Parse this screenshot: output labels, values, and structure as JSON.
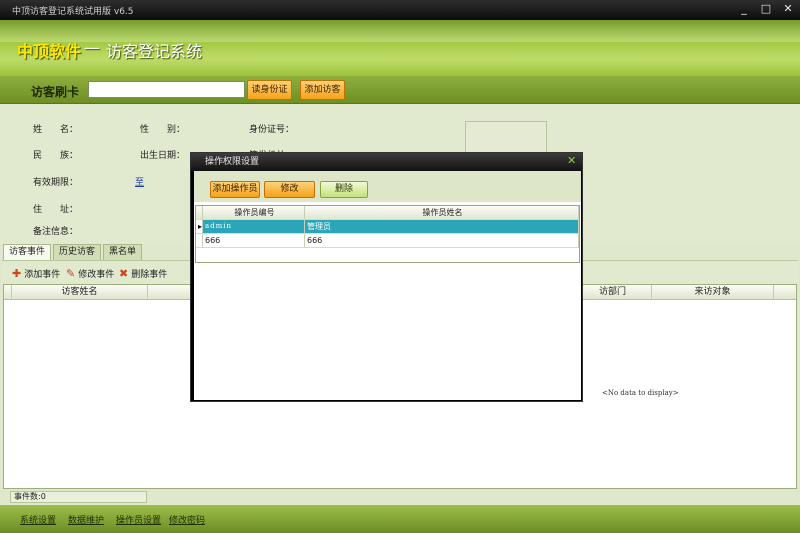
{
  "window": {
    "title": "中顶访客登记系统试用版 v6.5",
    "min": "_",
    "max": "□",
    "close": "✕"
  },
  "banner": {
    "brand": "中顶软件",
    "sep": "—",
    "subtitle": "访客登记系统"
  },
  "card": {
    "label": "访客刷卡",
    "input_value": "",
    "read_id_button": "读身份证",
    "add_visitor_button": "添加访客"
  },
  "info": {
    "name_label": "姓　　名：",
    "gender_label": "性　　别：",
    "id_label": "身份证号：",
    "ethnic_label": "民　　族：",
    "birth_label": "出生日期：",
    "issuer_label": "签发机关：",
    "valid_label": "有效期限：",
    "valid_to": "至",
    "address_label": "住　　址：",
    "remark_label": "备注信息："
  },
  "tabs": [
    "访客事件",
    "历史访客",
    "黑名单"
  ],
  "toolbar": {
    "add": "添加事件",
    "edit": "修改事件",
    "delete": "删除事件"
  },
  "grid": {
    "columns": [
      "访客姓名",
      "访部门",
      "来访对象"
    ],
    "empty": "<No data to display>"
  },
  "status": {
    "count": "事件数:0"
  },
  "bottom": [
    "系统设置",
    "数据维护",
    "操作员设置",
    "修改密码"
  ],
  "dialog": {
    "title": "操作权限设置",
    "add": "添加操作员",
    "edit": "修改",
    "delete": "删除",
    "columns": [
      "操作员编号",
      "操作员姓名"
    ],
    "rows": [
      {
        "id": "admin",
        "name": "管理员"
      },
      {
        "id": "666",
        "name": "666"
      }
    ]
  }
}
